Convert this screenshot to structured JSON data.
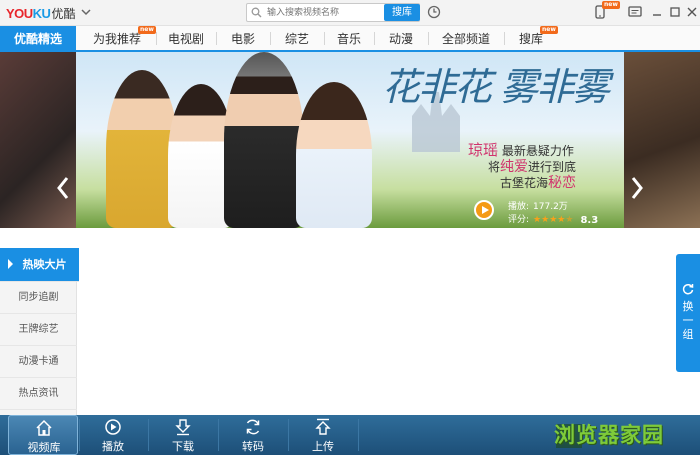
{
  "app": {
    "logo_you": "YOU",
    "logo_ku": "KU",
    "logo_cn": "优酷"
  },
  "search": {
    "placeholder": "输入搜索视频名称",
    "button": "搜库"
  },
  "top_badge": "new",
  "tabs": [
    {
      "label": "优酷精选",
      "active": true
    },
    {
      "label": "为我推荐",
      "badge": "new"
    },
    {
      "label": "电视剧"
    },
    {
      "label": "电影"
    },
    {
      "label": "综艺"
    },
    {
      "label": "音乐"
    },
    {
      "label": "动漫"
    },
    {
      "label": "全部频道"
    },
    {
      "label": "搜库",
      "badge": "new"
    }
  ],
  "banner": {
    "title": "花非花 雾非雾",
    "line1_accent": "琼瑶",
    "line1_rest": "最新悬疑力作",
    "line2_pre": "将",
    "line2_accent": "纯爱",
    "line2_rest": "进行到底",
    "line3_pre": "古堡花海",
    "line3_accent": "秘恋",
    "plays_label": "播放:",
    "plays_value": "177.2万",
    "rating_label": "评分:",
    "rating_value": "8.3"
  },
  "sidebar": {
    "items": [
      {
        "label": "热映大片",
        "active": true
      },
      {
        "label": "同步追剧"
      },
      {
        "label": "王牌综艺"
      },
      {
        "label": "动漫卡通"
      },
      {
        "label": "热点资讯"
      }
    ]
  },
  "swap": {
    "label": "换一组"
  },
  "toolbar": {
    "items": [
      {
        "label": "视频库",
        "icon": "home-icon",
        "active": true
      },
      {
        "label": "播放",
        "icon": "play-icon"
      },
      {
        "label": "下载",
        "icon": "download-icon"
      },
      {
        "label": "转码",
        "icon": "convert-icon"
      },
      {
        "label": "上传",
        "icon": "upload-icon"
      }
    ]
  },
  "watermark": "浏览器家园",
  "colors": {
    "accent": "#1a8fe3",
    "toolbar": "#1d4f78",
    "badge": "#f26a1b",
    "highlight": "#d0346d"
  }
}
